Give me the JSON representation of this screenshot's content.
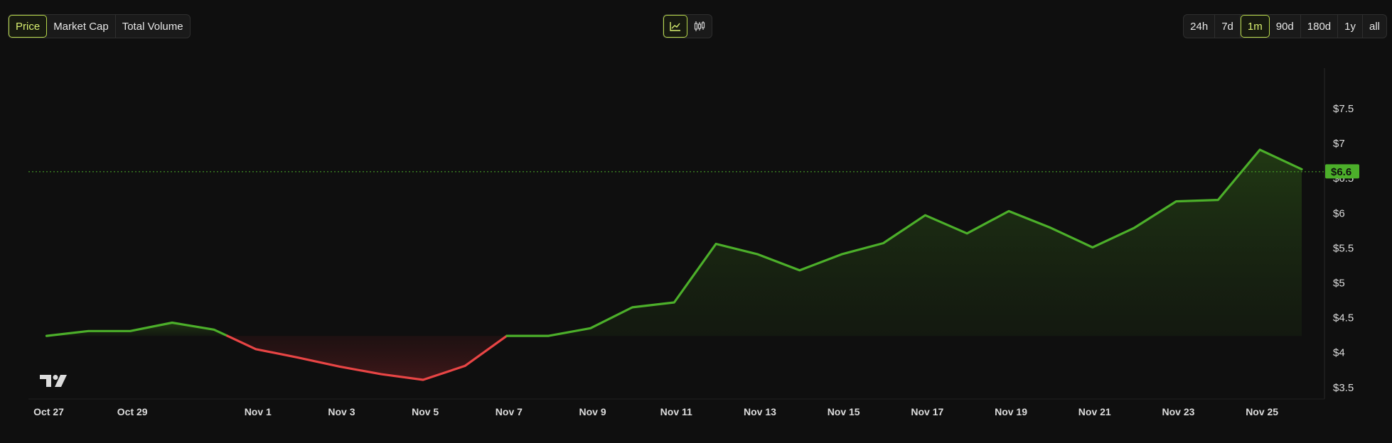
{
  "toolbar": {
    "metrics": [
      {
        "label": "Price",
        "active": true
      },
      {
        "label": "Market Cap",
        "active": false
      },
      {
        "label": "Total Volume",
        "active": false
      }
    ],
    "chart_types": [
      {
        "icon": "line-chart-icon",
        "active": true
      },
      {
        "icon": "candlestick-chart-icon",
        "active": false
      }
    ],
    "ranges": [
      {
        "label": "24h",
        "active": false
      },
      {
        "label": "7d",
        "active": false
      },
      {
        "label": "1m",
        "active": true
      },
      {
        "label": "90d",
        "active": false
      },
      {
        "label": "180d",
        "active": false
      },
      {
        "label": "1y",
        "active": false
      },
      {
        "label": "all",
        "active": false
      }
    ]
  },
  "colors": {
    "up": "#4caf2a",
    "down": "#e84545",
    "accent": "#b7d94a",
    "badge": "#4caf2a"
  },
  "chart_data": {
    "type": "area",
    "x_tick_labels": [
      "Oct 27",
      "Oct 29",
      "Nov 1",
      "Nov 3",
      "Nov 5",
      "Nov 7",
      "Nov 9",
      "Nov 11",
      "Nov 13",
      "Nov 15",
      "Nov 17",
      "Nov 19",
      "Nov 21",
      "Nov 23",
      "Nov 25"
    ],
    "x_tick_bold": [
      false,
      false,
      true,
      false,
      false,
      false,
      false,
      false,
      false,
      false,
      false,
      false,
      false,
      false,
      false
    ],
    "y_tick_labels": [
      "$3.5",
      "$4",
      "$4.5",
      "$5",
      "$5.5",
      "$6",
      "$6.5",
      "$7",
      "$7.5"
    ],
    "y_ticks": [
      3.5,
      4,
      4.5,
      5,
      5.5,
      6,
      6.5,
      7,
      7.5
    ],
    "ylim": [
      3.0,
      7.9
    ],
    "baseline": 4.24,
    "current_price_label": "$6.6",
    "current_price": 6.6,
    "points": [
      {
        "x": "Oct 27",
        "y": 4.24
      },
      {
        "x": "Oct 28",
        "y": 4.31
      },
      {
        "x": "Oct 29",
        "y": 4.31
      },
      {
        "x": "Oct 30",
        "y": 4.43
      },
      {
        "x": "Oct 31",
        "y": 4.33
      },
      {
        "x": "Nov 1",
        "y": 4.05
      },
      {
        "x": "Nov 2",
        "y": 3.93
      },
      {
        "x": "Nov 3",
        "y": 3.8
      },
      {
        "x": "Nov 4",
        "y": 3.69
      },
      {
        "x": "Nov 5",
        "y": 3.61
      },
      {
        "x": "Nov 6",
        "y": 3.81
      },
      {
        "x": "Nov 7",
        "y": 4.24
      },
      {
        "x": "Nov 8",
        "y": 4.24
      },
      {
        "x": "Nov 9",
        "y": 4.35
      },
      {
        "x": "Nov 10",
        "y": 4.65
      },
      {
        "x": "Nov 11",
        "y": 4.72
      },
      {
        "x": "Nov 12",
        "y": 5.56
      },
      {
        "x": "Nov 13",
        "y": 5.41
      },
      {
        "x": "Nov 14",
        "y": 5.18
      },
      {
        "x": "Nov 15",
        "y": 5.41
      },
      {
        "x": "Nov 16",
        "y": 5.57
      },
      {
        "x": "Nov 17",
        "y": 5.97
      },
      {
        "x": "Nov 18",
        "y": 5.71
      },
      {
        "x": "Nov 19",
        "y": 6.03
      },
      {
        "x": "Nov 20",
        "y": 5.79
      },
      {
        "x": "Nov 21",
        "y": 5.51
      },
      {
        "x": "Nov 22",
        "y": 5.79
      },
      {
        "x": "Nov 23",
        "y": 6.17
      },
      {
        "x": "Nov 24",
        "y": 6.19
      },
      {
        "x": "Nov 25",
        "y": 6.91
      },
      {
        "x": "Nov 26",
        "y": 6.63
      }
    ]
  }
}
